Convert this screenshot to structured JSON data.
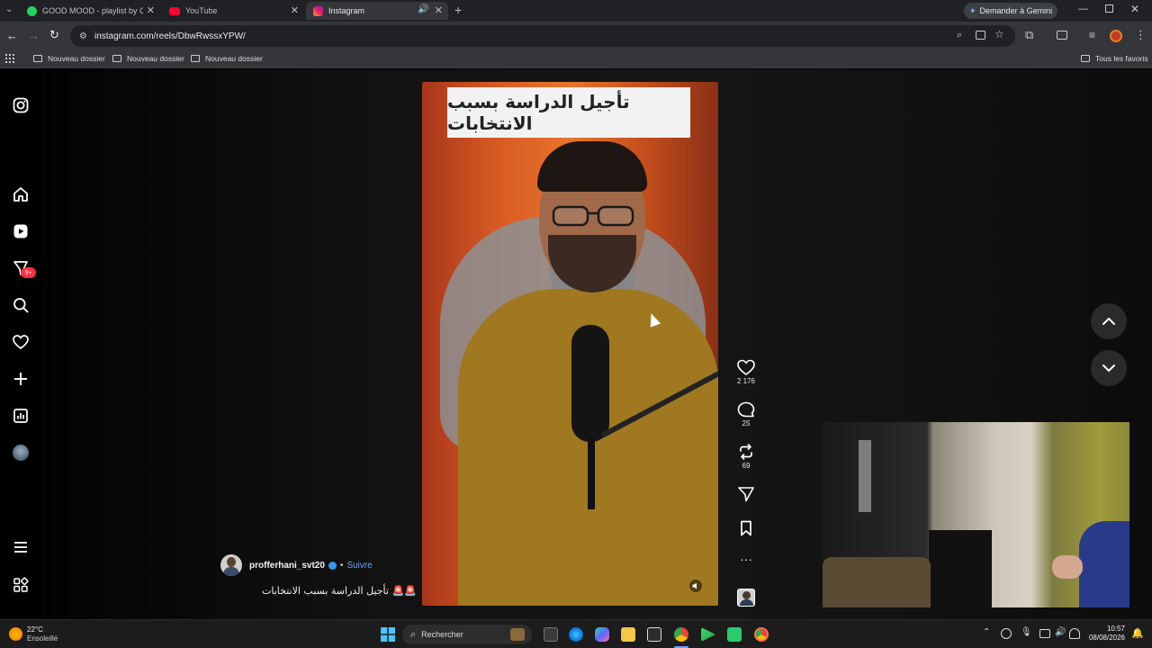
{
  "browser": {
    "tabs": [
      {
        "title": "GOOD MOOD - playlist by Cas",
        "active": false
      },
      {
        "title": "YouTube",
        "active": false
      },
      {
        "title": "Instagram",
        "active": true
      }
    ],
    "url": "instagram.com/reels/DbwRwssxYPW/",
    "gemini_label": "Demander à Gemini",
    "bookmarks": [
      "Nouveau dossier",
      "Nouveau dossier",
      "Nouveau dossier"
    ],
    "all_bookmarks_label": "Tous les favoris"
  },
  "sidebar": {
    "items": [
      {
        "name": "instagram-logo-icon"
      },
      {
        "name": "home-icon"
      },
      {
        "name": "reels-icon"
      },
      {
        "name": "messages-icon",
        "badge": "9+"
      },
      {
        "name": "search-icon"
      },
      {
        "name": "notifications-icon"
      },
      {
        "name": "create-icon"
      },
      {
        "name": "dashboard-icon"
      },
      {
        "name": "profile-icon"
      },
      {
        "name": "more-icon"
      },
      {
        "name": "apps-icon"
      }
    ]
  },
  "reel": {
    "banner_text": "تأجيل الدراسة بسبب الانتخابات",
    "author": "profferhani_svt20",
    "follow_label": "Suivre",
    "caption": "تأجيل الدراسة بسبب الانتخابات 🚨🚨",
    "likes": "2 176",
    "comments": "25",
    "reposts": "69"
  },
  "taskbar": {
    "weather_temp": "22°C",
    "weather_desc": "Ensoleillé",
    "search_placeholder": "Rechercher",
    "time": "10:57",
    "date": "08/08/2026"
  },
  "colors": {
    "tab_bar": "#202124",
    "toolbar": "#35363a",
    "follow": "#6ea4ff",
    "badge": "#ff3040"
  }
}
